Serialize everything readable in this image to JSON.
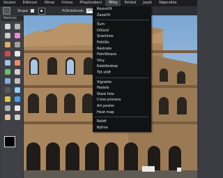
{
  "menubar": {
    "items": [
      {
        "label": "Soubor"
      },
      {
        "label": "Editovat"
      },
      {
        "label": "Obraz"
      },
      {
        "label": "Vrstva"
      },
      {
        "label": "Přizpůsobení"
      },
      {
        "label": "Filtry"
      },
      {
        "label": "Pohled"
      },
      {
        "label": "Jazyk"
      },
      {
        "label": "Nápověda"
      }
    ]
  },
  "optbar": {
    "stopa_label": "Stopa:",
    "opacity_label": "Průhlednost:",
    "opacity_value": "100"
  },
  "tools": {
    "title": "Nástroje",
    "items": [
      {
        "icon": "marquee-icon",
        "color": "#d8d8d8"
      },
      {
        "icon": "move-icon",
        "color": "#b7b7b7"
      },
      {
        "icon": "lasso-icon",
        "color": "#c9c9c9"
      },
      {
        "icon": "wand-icon",
        "color": "#e28bd4"
      },
      {
        "icon": "crop-icon",
        "color": "#e0b060"
      },
      {
        "icon": "slice-icon",
        "color": "#a0a0a0"
      },
      {
        "icon": "pencil-icon",
        "color": "#d24a4a"
      },
      {
        "icon": "brush-icon",
        "color": "#e8e8e8"
      },
      {
        "icon": "clone-icon",
        "color": "#9ec9e8"
      },
      {
        "icon": "eraser-icon",
        "color": "#ef8c6b"
      },
      {
        "icon": "bucket-icon",
        "color": "#6bbf6b"
      },
      {
        "icon": "gradient-icon",
        "color": "#d0d0d0"
      },
      {
        "icon": "blur-icon",
        "color": "#7fb0e0"
      },
      {
        "icon": "sharpen-icon",
        "color": "#c0c0c0"
      },
      {
        "icon": "dodge-icon",
        "color": "#5a5a5a"
      },
      {
        "icon": "burn-icon",
        "color": "#8fd0ff"
      },
      {
        "icon": "sponge-icon",
        "color": "#d9c84c"
      },
      {
        "icon": "colorize-icon",
        "color": "#4c9fe0"
      },
      {
        "icon": "eyedropper-icon",
        "color": "#b0b0b0"
      },
      {
        "icon": "text-icon",
        "color": "#e6e6e6"
      },
      {
        "icon": "hand-icon",
        "color": "#e0c0a0"
      },
      {
        "icon": "zoom-icon",
        "color": "#cccccc"
      }
    ],
    "fg_color": "#000000",
    "bg_color": "#ffffff"
  },
  "filter_menu": {
    "groups": [
      [
        {
          "label": "Rozostřit",
          "disabled": false
        },
        {
          "label": "Zaostřit",
          "disabled": false
        }
      ],
      [
        {
          "label": "Šum",
          "disabled": false
        },
        {
          "label": "Difúzní",
          "disabled": false
        },
        {
          "label": "Scanlines",
          "disabled": false
        },
        {
          "label": "Pohlížo",
          "disabled": false
        },
        {
          "label": "Rastrate",
          "disabled": false
        },
        {
          "label": "Pointilizace",
          "disabled": false
        },
        {
          "label": "Vlny",
          "disabled": false
        },
        {
          "label": "Kaleidoskop",
          "disabled": false
        },
        {
          "label": "Tilt shift",
          "disabled": false
        }
      ],
      [
        {
          "label": "Vignette",
          "disabled": false
        },
        {
          "label": "Pastels",
          "disabled": false
        },
        {
          "label": "Staré foto",
          "disabled": false
        },
        {
          "label": "Cross process",
          "disabled": false
        },
        {
          "label": "Art poster",
          "disabled": false
        },
        {
          "label": "Heat map",
          "disabled": false
        }
      ],
      [
        {
          "label": "Reliéf",
          "disabled": false
        },
        {
          "label": "Rytina",
          "disabled": false
        }
      ]
    ]
  },
  "canvas": {
    "photo_description_colors": {
      "stone": "#a8855c",
      "stone_dark": "#6d5136",
      "arch_shadow": "#2b2520",
      "ground": "#5f5a52"
    }
  }
}
